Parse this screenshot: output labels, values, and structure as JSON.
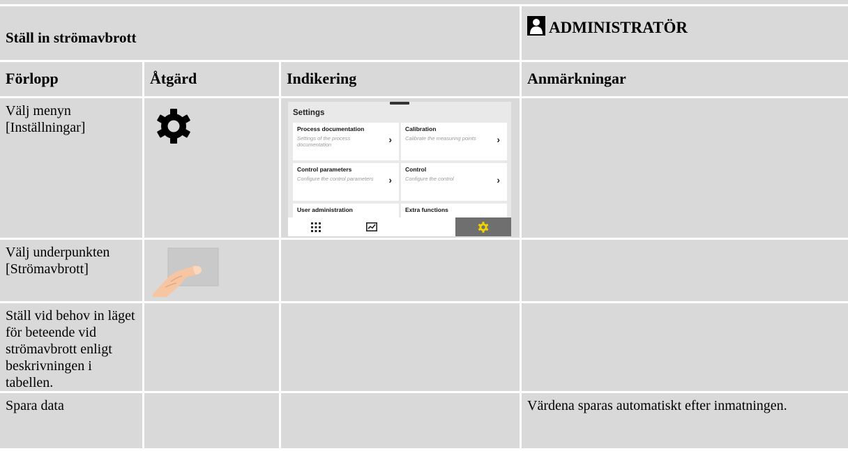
{
  "header": {
    "title": "Ställ in strömavbrott",
    "role": "ADMINISTRATÖR"
  },
  "columns": [
    "Förlopp",
    "Åtgärd",
    "Indikering",
    "Anmärkningar"
  ],
  "rows": [
    {
      "step": "Välj menyn [Inställningar]",
      "remark": ""
    },
    {
      "step": "Välj underpunkten [Strömavbrott]",
      "remark": ""
    },
    {
      "step": "Ställ vid behov in läget för beteende vid strömavbrott enligt beskrivningen i tabellen.",
      "remark": ""
    },
    {
      "step": "Spara data",
      "remark": "Värdena sparas automatiskt efter inmatningen."
    }
  ],
  "screen": {
    "title": "Settings",
    "tiles": [
      {
        "title": "Process documentation",
        "subtitle": "Settings of the process documentation"
      },
      {
        "title": "Calibration",
        "subtitle": "Calibrate the measuring points"
      },
      {
        "title": "Control parameters",
        "subtitle": "Configure the control parameters"
      },
      {
        "title": "Control",
        "subtitle": "Configure the control"
      },
      {
        "title": "User administration",
        "subtitle": ""
      },
      {
        "title": "Extra functions",
        "subtitle": ""
      }
    ],
    "chevron": "›",
    "nav": [
      "grid-icon",
      "chart-icon",
      "gear-icon"
    ],
    "active_nav_color": "#6f6f6f",
    "gear_accent": "#f2d200"
  },
  "icons": {
    "role_icon": "person-icon",
    "action_row1": "gear-icon",
    "action_row2": "finger-tap-icon"
  }
}
